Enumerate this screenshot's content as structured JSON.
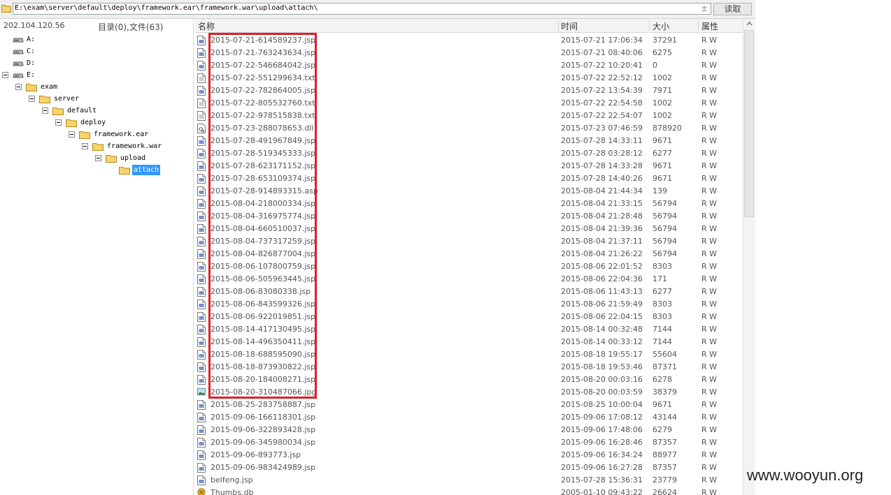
{
  "address": {
    "path": "E:\\exam\\server\\default\\deploy\\framework.ear\\framework.war\\upload\\attach\\",
    "pm_symbol": "±",
    "read_label": "读取"
  },
  "left": {
    "ip": "202.104.120.56",
    "dir_count": "目录(0),文件(63)",
    "tree": [
      {
        "label": "A:",
        "type": "drive"
      },
      {
        "label": "C:",
        "type": "drive"
      },
      {
        "label": "D:",
        "type": "drive"
      },
      {
        "label": "E:",
        "type": "drive"
      },
      {
        "label": "exam",
        "type": "folder"
      },
      {
        "label": "server",
        "type": "folder"
      },
      {
        "label": "default",
        "type": "folder"
      },
      {
        "label": "deploy",
        "type": "folder"
      },
      {
        "label": "framework.ear",
        "type": "folder"
      },
      {
        "label": "framework.war",
        "type": "folder"
      },
      {
        "label": "upload",
        "type": "folder"
      },
      {
        "label": "attach",
        "type": "folder",
        "selected": true
      }
    ]
  },
  "columns": {
    "name": "名称",
    "time": "时间",
    "size": "大小",
    "attr": "属性"
  },
  "files": [
    {
      "name": "2015-07-21-614589237.jsp",
      "time": "2015-07-21 17:06:34",
      "size": "37291",
      "attr": "R W",
      "icon": "doc"
    },
    {
      "name": "2015-07-21-763243634.jsp",
      "time": "2015-07-21 08:40:06",
      "size": "6275",
      "attr": "R W",
      "icon": "doc"
    },
    {
      "name": "2015-07-22-546684042.jsp",
      "time": "2015-07-22 10:20:41",
      "size": "0",
      "attr": "R W",
      "icon": "doc"
    },
    {
      "name": "2015-07-22-551299634.txt",
      "time": "2015-07-22 22:52:12",
      "size": "1002",
      "attr": "R W",
      "icon": "txt"
    },
    {
      "name": "2015-07-22-782864005.jsp",
      "time": "2015-07-22 13:54:39",
      "size": "7971",
      "attr": "R W",
      "icon": "doc"
    },
    {
      "name": "2015-07-22-805532760.txt",
      "time": "2015-07-22 22:54:58",
      "size": "1002",
      "attr": "R W",
      "icon": "txt"
    },
    {
      "name": "2015-07-22-978515838.txt",
      "time": "2015-07-22 22:54:07",
      "size": "1002",
      "attr": "R W",
      "icon": "txt"
    },
    {
      "name": "2015-07-23-288078653.dll",
      "time": "2015-07-23 07:46:59",
      "size": "878920",
      "attr": "R W",
      "icon": "dll"
    },
    {
      "name": "2015-07-28-491967849.jsp",
      "time": "2015-07-28 14:33:11",
      "size": "9671",
      "attr": "R W",
      "icon": "doc"
    },
    {
      "name": "2015-07-28-519345333.jsp",
      "time": "2015-07-28 03:28:12",
      "size": "6277",
      "attr": "R W",
      "icon": "doc"
    },
    {
      "name": "2015-07-28-623171152.jsp",
      "time": "2015-07-28 14:33:28",
      "size": "9671",
      "attr": "R W",
      "icon": "doc"
    },
    {
      "name": "2015-07-28-653109374.jsp",
      "time": "2015-07-28 14:40:26",
      "size": "9671",
      "attr": "R W",
      "icon": "doc"
    },
    {
      "name": "2015-07-28-914893315.asp",
      "time": "2015-08-04 21:44:34",
      "size": "139",
      "attr": "R W",
      "icon": "doc"
    },
    {
      "name": "2015-08-04-218000334.jsp",
      "time": "2015-08-04 21:33:15",
      "size": "56794",
      "attr": "R W",
      "icon": "doc"
    },
    {
      "name": "2015-08-04-316975774.jsp",
      "time": "2015-08-04 21:28:48",
      "size": "56794",
      "attr": "R W",
      "icon": "doc"
    },
    {
      "name": "2015-08-04-660510037.jsp",
      "time": "2015-08-04 21:39:36",
      "size": "56794",
      "attr": "R W",
      "icon": "doc"
    },
    {
      "name": "2015-08-04-737317259.jsp",
      "time": "2015-08-04 21:37:11",
      "size": "56794",
      "attr": "R W",
      "icon": "doc"
    },
    {
      "name": "2015-08-04-826877004.jsp",
      "time": "2015-08-04 21:26:22",
      "size": "56794",
      "attr": "R W",
      "icon": "doc"
    },
    {
      "name": "2015-08-06-107800759.jsp",
      "time": "2015-08-06 22:01:52",
      "size": "8303",
      "attr": "R W",
      "icon": "doc"
    },
    {
      "name": "2015-08-06-505963445.jsp",
      "time": "2015-08-06 22:04:36",
      "size": "171",
      "attr": "R W",
      "icon": "doc"
    },
    {
      "name": "2015-08-06-83080338.jsp",
      "time": "2015-08-06 11:43:13",
      "size": "6277",
      "attr": "R W",
      "icon": "doc"
    },
    {
      "name": "2015-08-06-843599326.jsp",
      "time": "2015-08-06 21:59:49",
      "size": "8303",
      "attr": "R W",
      "icon": "doc"
    },
    {
      "name": "2015-08-06-922019851.jsp",
      "time": "2015-08-06 22:04:15",
      "size": "8303",
      "attr": "R W",
      "icon": "doc"
    },
    {
      "name": "2015-08-14-417130495.jsp",
      "time": "2015-08-14 00:32:48",
      "size": "7144",
      "attr": "R W",
      "icon": "doc"
    },
    {
      "name": "2015-08-14-496350411.jsp",
      "time": "2015-08-14 00:33:12",
      "size": "7144",
      "attr": "R W",
      "icon": "doc"
    },
    {
      "name": "2015-08-18-688595090.jsp",
      "time": "2015-08-18 19:55:17",
      "size": "55604",
      "attr": "R W",
      "icon": "doc"
    },
    {
      "name": "2015-08-18-873930822.jsp",
      "time": "2015-08-18 19:53:46",
      "size": "87371",
      "attr": "R W",
      "icon": "doc"
    },
    {
      "name": "2015-08-20-184008271.jsp",
      "time": "2015-08-20 00:03:16",
      "size": "6278",
      "attr": "R W",
      "icon": "doc"
    },
    {
      "name": "2015-08-20-310487066.jpg",
      "time": "2015-08-20 00:03:59",
      "size": "38379",
      "attr": "R W",
      "icon": "img"
    },
    {
      "name": "2015-08-25-283758887.jsp",
      "time": "2015-08-25 10:00:04",
      "size": "9671",
      "attr": "R W",
      "icon": "doc"
    },
    {
      "name": "2015-09-06-166118301.jsp",
      "time": "2015-09-06 17:08:12",
      "size": "43144",
      "attr": "R W",
      "icon": "doc"
    },
    {
      "name": "2015-09-06-322893428.jsp",
      "time": "2015-09-06 17:48:06",
      "size": "6279",
      "attr": "R W",
      "icon": "doc"
    },
    {
      "name": "2015-09-06-345980034.jsp",
      "time": "2015-09-06 16:28:46",
      "size": "87357",
      "attr": "R W",
      "icon": "doc"
    },
    {
      "name": "2015-09-06-893773.jsp",
      "time": "2015-09-06 16:34:24",
      "size": "88977",
      "attr": "R W",
      "icon": "doc"
    },
    {
      "name": "2015-09-06-983424989.jsp",
      "time": "2015-09-06 16:27:28",
      "size": "87357",
      "attr": "R W",
      "icon": "doc"
    },
    {
      "name": "beifeng.jsp",
      "time": "2015-07-28 15:36:31",
      "size": "23779",
      "attr": "R W",
      "icon": "doc"
    },
    {
      "name": "Thumbs.db",
      "time": "2005-01-10 09:43:22",
      "size": "26624",
      "attr": "R W",
      "icon": "db"
    }
  ],
  "watermark": "www.wooyun.org",
  "colors": {
    "highlight": "#e01e26",
    "selection": "#3399ff"
  }
}
